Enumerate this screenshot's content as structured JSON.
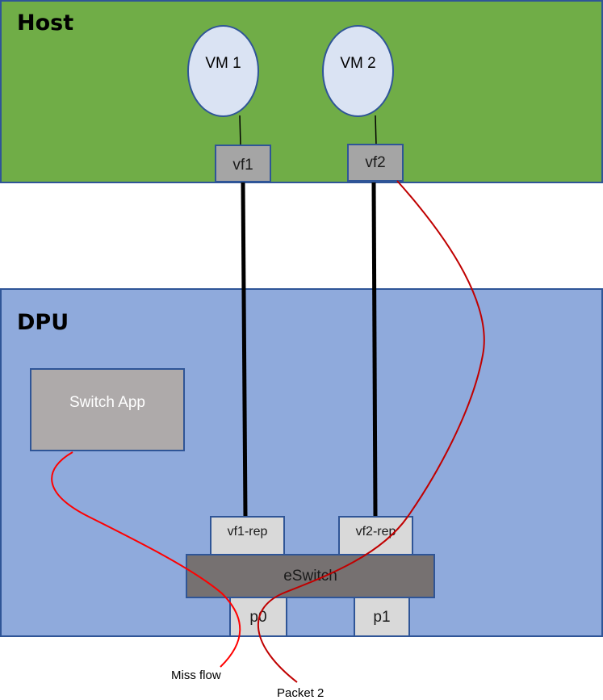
{
  "host": {
    "label": "Host",
    "color": "#70ad47",
    "vms": [
      {
        "label": "VM 1"
      },
      {
        "label": "VM 2"
      }
    ],
    "vfs": [
      {
        "label": "vf1"
      },
      {
        "label": "vf2"
      }
    ]
  },
  "dpu": {
    "label": "DPU",
    "color": "#8faadc",
    "switch_app": {
      "label": "Switch App"
    },
    "reps": [
      {
        "label": "vf1-rep"
      },
      {
        "label": "vf2-rep"
      }
    ],
    "eswitch": {
      "label": "eSwitch"
    },
    "ports": [
      {
        "label": "p0"
      },
      {
        "label": "p1"
      }
    ]
  },
  "flows": [
    {
      "label": "Miss flow",
      "color": "#ff0000"
    },
    {
      "label": "Packet 2",
      "color": "#c00000"
    }
  ]
}
